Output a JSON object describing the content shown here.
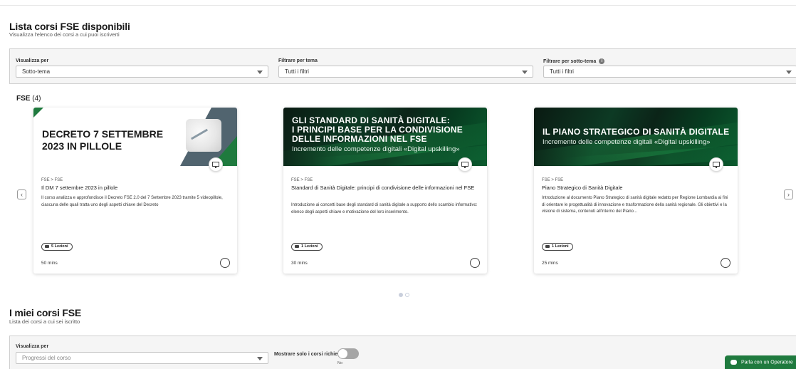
{
  "available": {
    "title": "Lista corsi FSE disponibili",
    "subtitle": "Visualizza l'elenco dei corsi a cui puoi iscriverti"
  },
  "filters": {
    "view_label": "Visualizza per",
    "view_value": "Sotto-tema",
    "theme_label": "Filtrare per tema",
    "theme_value": "Tutti i filtri",
    "subtheme_label": "Filtrare per sotto-tema",
    "subtheme_value": "Tutti i filtri"
  },
  "carousel": {
    "heading": "FSE",
    "count": "(4)",
    "prev_icon": "chevron-left-icon",
    "next_icon": "chevron-right-icon",
    "pages": 2,
    "active_page": 1
  },
  "courses": [
    {
      "image_title_line1": "DECRETO 7 SETTEMBRE",
      "image_title_line2": "2023 IN PILLOLE",
      "breadcrumb": "FSE > FSE",
      "title": "Il DM 7 settembre 2023 in pillole",
      "description": "Il corso analizza e approfondisce il Decreto FSE 2.0 del 7 Settembre 2023 tramite 5 videopillole, ciascuna delle quali tratta uno degli aspetti chiave del Decreto",
      "lessons": "5 Lezioni",
      "duration": "50 mins"
    },
    {
      "image_title_line1": "GLI STANDARD DI SANITÀ DIGITALE:",
      "image_title_line2": "I PRINCIPI BASE PER LA CONDIVISIONE",
      "image_title_line3": "DELLE INFORMAZIONI NEL FSE",
      "image_subtitle": "Incremento delle competenze digitali «Digital upskilling»",
      "breadcrumb": "FSE > FSE",
      "title": "Standard di Sanità Digitale: principi di condivisione delle informazioni nel FSE",
      "description": "Introduzione ai concetti base degli standard di sanità digitale a supporto dello scambio informativo: elenco degli aspetti chiave e motivazione del loro inserimento.",
      "lessons": "1 Lezioni",
      "duration": "30 mins"
    },
    {
      "image_title_line1": "IL PIANO STRATEGICO DI SANITÀ DIGITALE",
      "image_subtitle": "Incremento delle competenze digitali «Digital upskilling»",
      "breadcrumb": "FSE > FSE",
      "title": "Piano Strategico di Sanità Digitale",
      "description": "Introduzione al documento Piano Strategico di sanità digitale redatto per Regione Lombardia ai fini di orientare le progettualità di innovazione e trasformazione della sanità regionale. Gli obiettivi e la visione di sistema, contenuti all'interno del Piano...",
      "lessons": "1 Lezioni",
      "duration": "25 mins"
    }
  ],
  "my_courses": {
    "title": "I miei corsi FSE",
    "subtitle": "Lista dei corsi a cui sei iscritto",
    "view_label": "Visualizza per",
    "view_value": "Progressi del corso",
    "toggle_label": "Mostrare solo i corsi richiesti",
    "toggle_state": "No"
  },
  "chat": {
    "label": "Parla con un Operatore"
  },
  "colors": {
    "brand_green": "#1f7a3e",
    "card_shadow": "#d0d0d0"
  }
}
